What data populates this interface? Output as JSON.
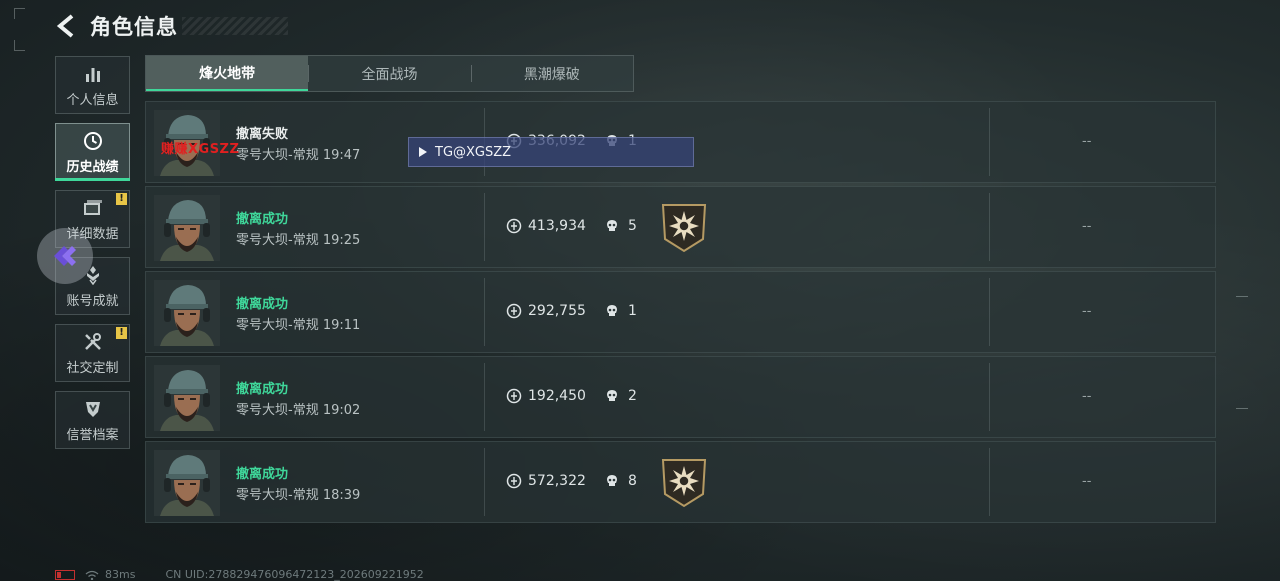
{
  "header": {
    "title": "角色信息"
  },
  "sidebar": {
    "items": [
      {
        "label": "个人信息",
        "icon": "bar-chart-icon",
        "active": false,
        "warn": false
      },
      {
        "label": "历史战绩",
        "icon": "clock-icon",
        "active": true,
        "warn": false
      },
      {
        "label": "详细数据",
        "icon": "folder-icon",
        "active": false,
        "warn": true
      },
      {
        "label": "账号成就",
        "icon": "achievement-icon",
        "active": false,
        "warn": false
      },
      {
        "label": "社交定制",
        "icon": "tools-icon",
        "active": false,
        "warn": true
      },
      {
        "label": "信誉档案",
        "icon": "shield-icon",
        "active": false,
        "warn": false
      }
    ],
    "warn_mark": "!"
  },
  "tabs": [
    {
      "label": "烽火地带",
      "active": true
    },
    {
      "label": "全面战场",
      "active": false
    },
    {
      "label": "黑潮爆破",
      "active": false
    }
  ],
  "matches": [
    {
      "status": "撤离失败",
      "success": false,
      "map": "零号大坝-常规 19:47",
      "value": "336,092",
      "kills": "1",
      "badge": false,
      "extra": "--"
    },
    {
      "status": "撤离成功",
      "success": true,
      "map": "零号大坝-常规 19:25",
      "value": "413,934",
      "kills": "5",
      "badge": true,
      "extra": "--"
    },
    {
      "status": "撤离成功",
      "success": true,
      "map": "零号大坝-常规 19:11",
      "value": "292,755",
      "kills": "1",
      "badge": false,
      "extra": "--"
    },
    {
      "status": "撤离成功",
      "success": true,
      "map": "零号大坝-常规 19:02",
      "value": "192,450",
      "kills": "2",
      "badge": false,
      "extra": "--"
    },
    {
      "status": "撤离成功",
      "success": true,
      "map": "零号大坝-常规 18:39",
      "value": "572,322",
      "kills": "8",
      "badge": true,
      "extra": "--"
    }
  ],
  "watermark": "赚赚XGSZZ",
  "overlay": {
    "text": "TG@XGSZZ"
  },
  "footer": {
    "ping": "83ms",
    "uid": "CN UID:278829476096472123_202609221952"
  },
  "colors": {
    "accent": "#3fd79a",
    "fail_text": "#e9eded",
    "warning": "#e8c547"
  }
}
